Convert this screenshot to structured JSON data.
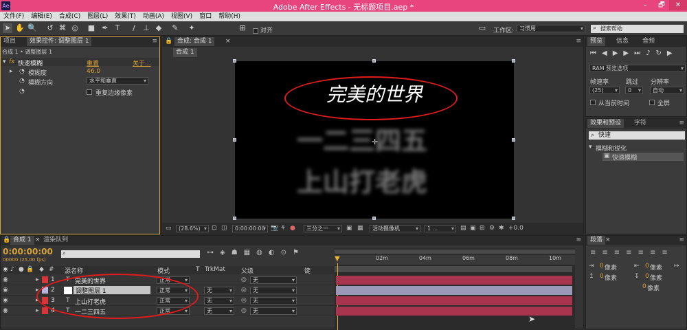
{
  "window": {
    "title": "Adobe After Effects - 无标题项目.aep *",
    "logo": "Ae",
    "minimize": "–",
    "restore": "🗗",
    "close": "✕"
  },
  "menu": [
    "文件(F)",
    "编辑(E)",
    "合成(C)",
    "图层(L)",
    "效果(T)",
    "动画(A)",
    "视图(V)",
    "窗口",
    "帮助(H)"
  ],
  "toolbar": {
    "snap_label": "对齐",
    "workspace_label": "工作区:",
    "workspace_value": "习惯用",
    "search_placeholder": "搜索帮助"
  },
  "effects_panel": {
    "tabs": [
      "项目",
      "效果控件: 调整图层 1"
    ],
    "breadcrumb": "合成 1 • 调整图层 1",
    "effect_name": "快速模糊",
    "reset": "重置",
    "about": "关于...",
    "blurriness_label": "模糊度",
    "blurriness_value": "46.0",
    "direction_label": "模糊方向",
    "direction_value": "水平和垂直",
    "repeat_label": "重复边缘像素",
    "fx": "fx"
  },
  "comp_panel": {
    "tab": "合成: 合成 1",
    "subtab": "合成 1",
    "title_text": "完美的世界",
    "line2": "一二三四五",
    "line3": "上山打老虎",
    "zoom": "(28.6%)",
    "timecode": "0:00:00:00",
    "resolution": "三分之一",
    "camera": "活动摄像机",
    "views": "1 ...",
    "exposure": "+0.0"
  },
  "preview_panel": {
    "tabs": [
      "预览",
      "信息",
      "音频"
    ],
    "ram_label": "RAM 预览选项",
    "frame_rate_label": "帧速率",
    "skip_label": "跳过",
    "resolution_label": "分辨率",
    "frame_rate_value": "(25)",
    "skip_value": "0",
    "resolution_value": "自动",
    "from_current": "从当前时间",
    "fullscreen": "全屏"
  },
  "effects_presets": {
    "tabs": [
      "效果和预设",
      "字符"
    ],
    "search_value": "快速",
    "category": "模糊和锐化",
    "item": "快速模糊"
  },
  "paragraph_panel": {
    "tab": "段落",
    "px_label": "像素",
    "values": [
      "0",
      "0",
      "0",
      "0",
      "0"
    ]
  },
  "timeline": {
    "tabs": [
      "合成 1",
      "渲染队列"
    ],
    "timecode": "0:00:00:00",
    "fps": "00000 (25.00 fps)",
    "search_placeholder": "",
    "col_source": "源名称",
    "col_mode": "模式",
    "col_t": "T",
    "col_trkmat": "TrkMat",
    "col_parent": "父级",
    "col_key": "键",
    "ruler": [
      "02m",
      "04m",
      "06m",
      "08m",
      "10m"
    ],
    "layers": [
      {
        "num": "1",
        "name": "完美的世界",
        "mode": "正常",
        "trkmat": "",
        "parent": "无",
        "color": "#d8353a",
        "type": "text"
      },
      {
        "num": "2",
        "name": "调整图层 1",
        "mode": "正常",
        "trkmat": "无",
        "parent": "无",
        "color": "#b6b6e0",
        "type": "adjust"
      },
      {
        "num": "3",
        "name": "上山打老虎",
        "mode": "正常",
        "trkmat": "无",
        "parent": "无",
        "color": "#d8353a",
        "type": "text"
      },
      {
        "num": "4",
        "name": "一二三四五",
        "mode": "正常",
        "trkmat": "无",
        "parent": "无",
        "color": "#d8353a",
        "type": "text"
      }
    ]
  },
  "colors": {
    "titlebar": "#e8457e",
    "accent": "#d7a33a",
    "bar": "#a8344d",
    "annotation": "#e21b1b"
  }
}
